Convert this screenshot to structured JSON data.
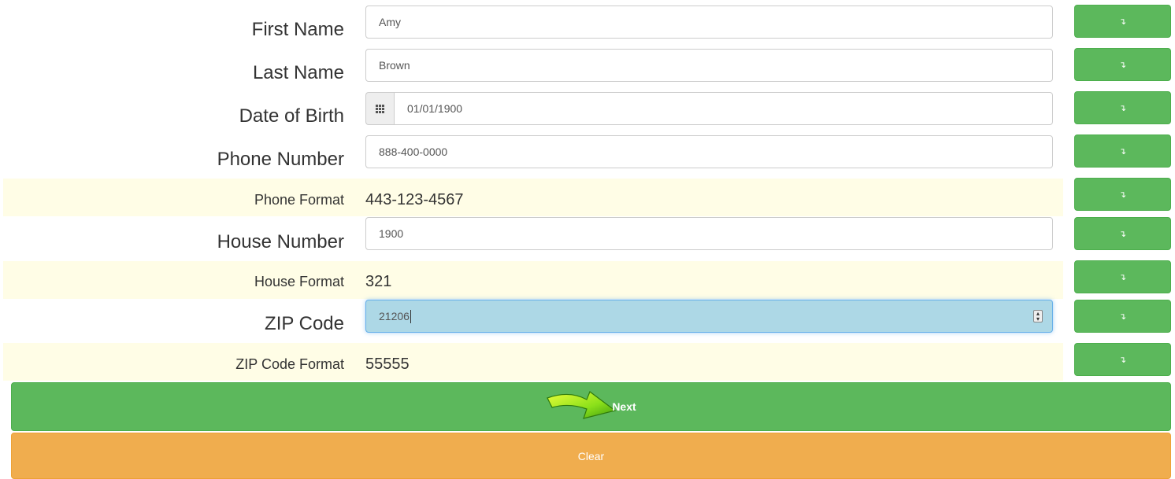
{
  "fields": {
    "first_name": {
      "label": "First Name",
      "value": "Amy"
    },
    "last_name": {
      "label": "Last Name",
      "value": "Brown"
    },
    "dob": {
      "label": "Date of Birth",
      "value": "01/01/1900"
    },
    "phone": {
      "label": "Phone Number",
      "value": "888-400-0000"
    },
    "phone_format": {
      "label": "Phone Format",
      "value": "443-123-4567"
    },
    "house": {
      "label": "House Number",
      "value": "1900"
    },
    "house_format": {
      "label": "House Format",
      "value": "321"
    },
    "zip": {
      "label": "ZIP Code",
      "value": "21206"
    },
    "zip_format": {
      "label": "ZIP Code Format",
      "value": "55555"
    }
  },
  "side_button_glyph": "↴",
  "buttons": {
    "next": "Next",
    "clear": "Clear"
  },
  "colors": {
    "success": "#5cb85c",
    "warning": "#f0ad4e",
    "hint_bg": "#fffde6",
    "focus_bg": "#add8e6"
  },
  "icons": {
    "calendar": "calendar-grid-icon",
    "next_arrow": "arrow-right-icon"
  }
}
